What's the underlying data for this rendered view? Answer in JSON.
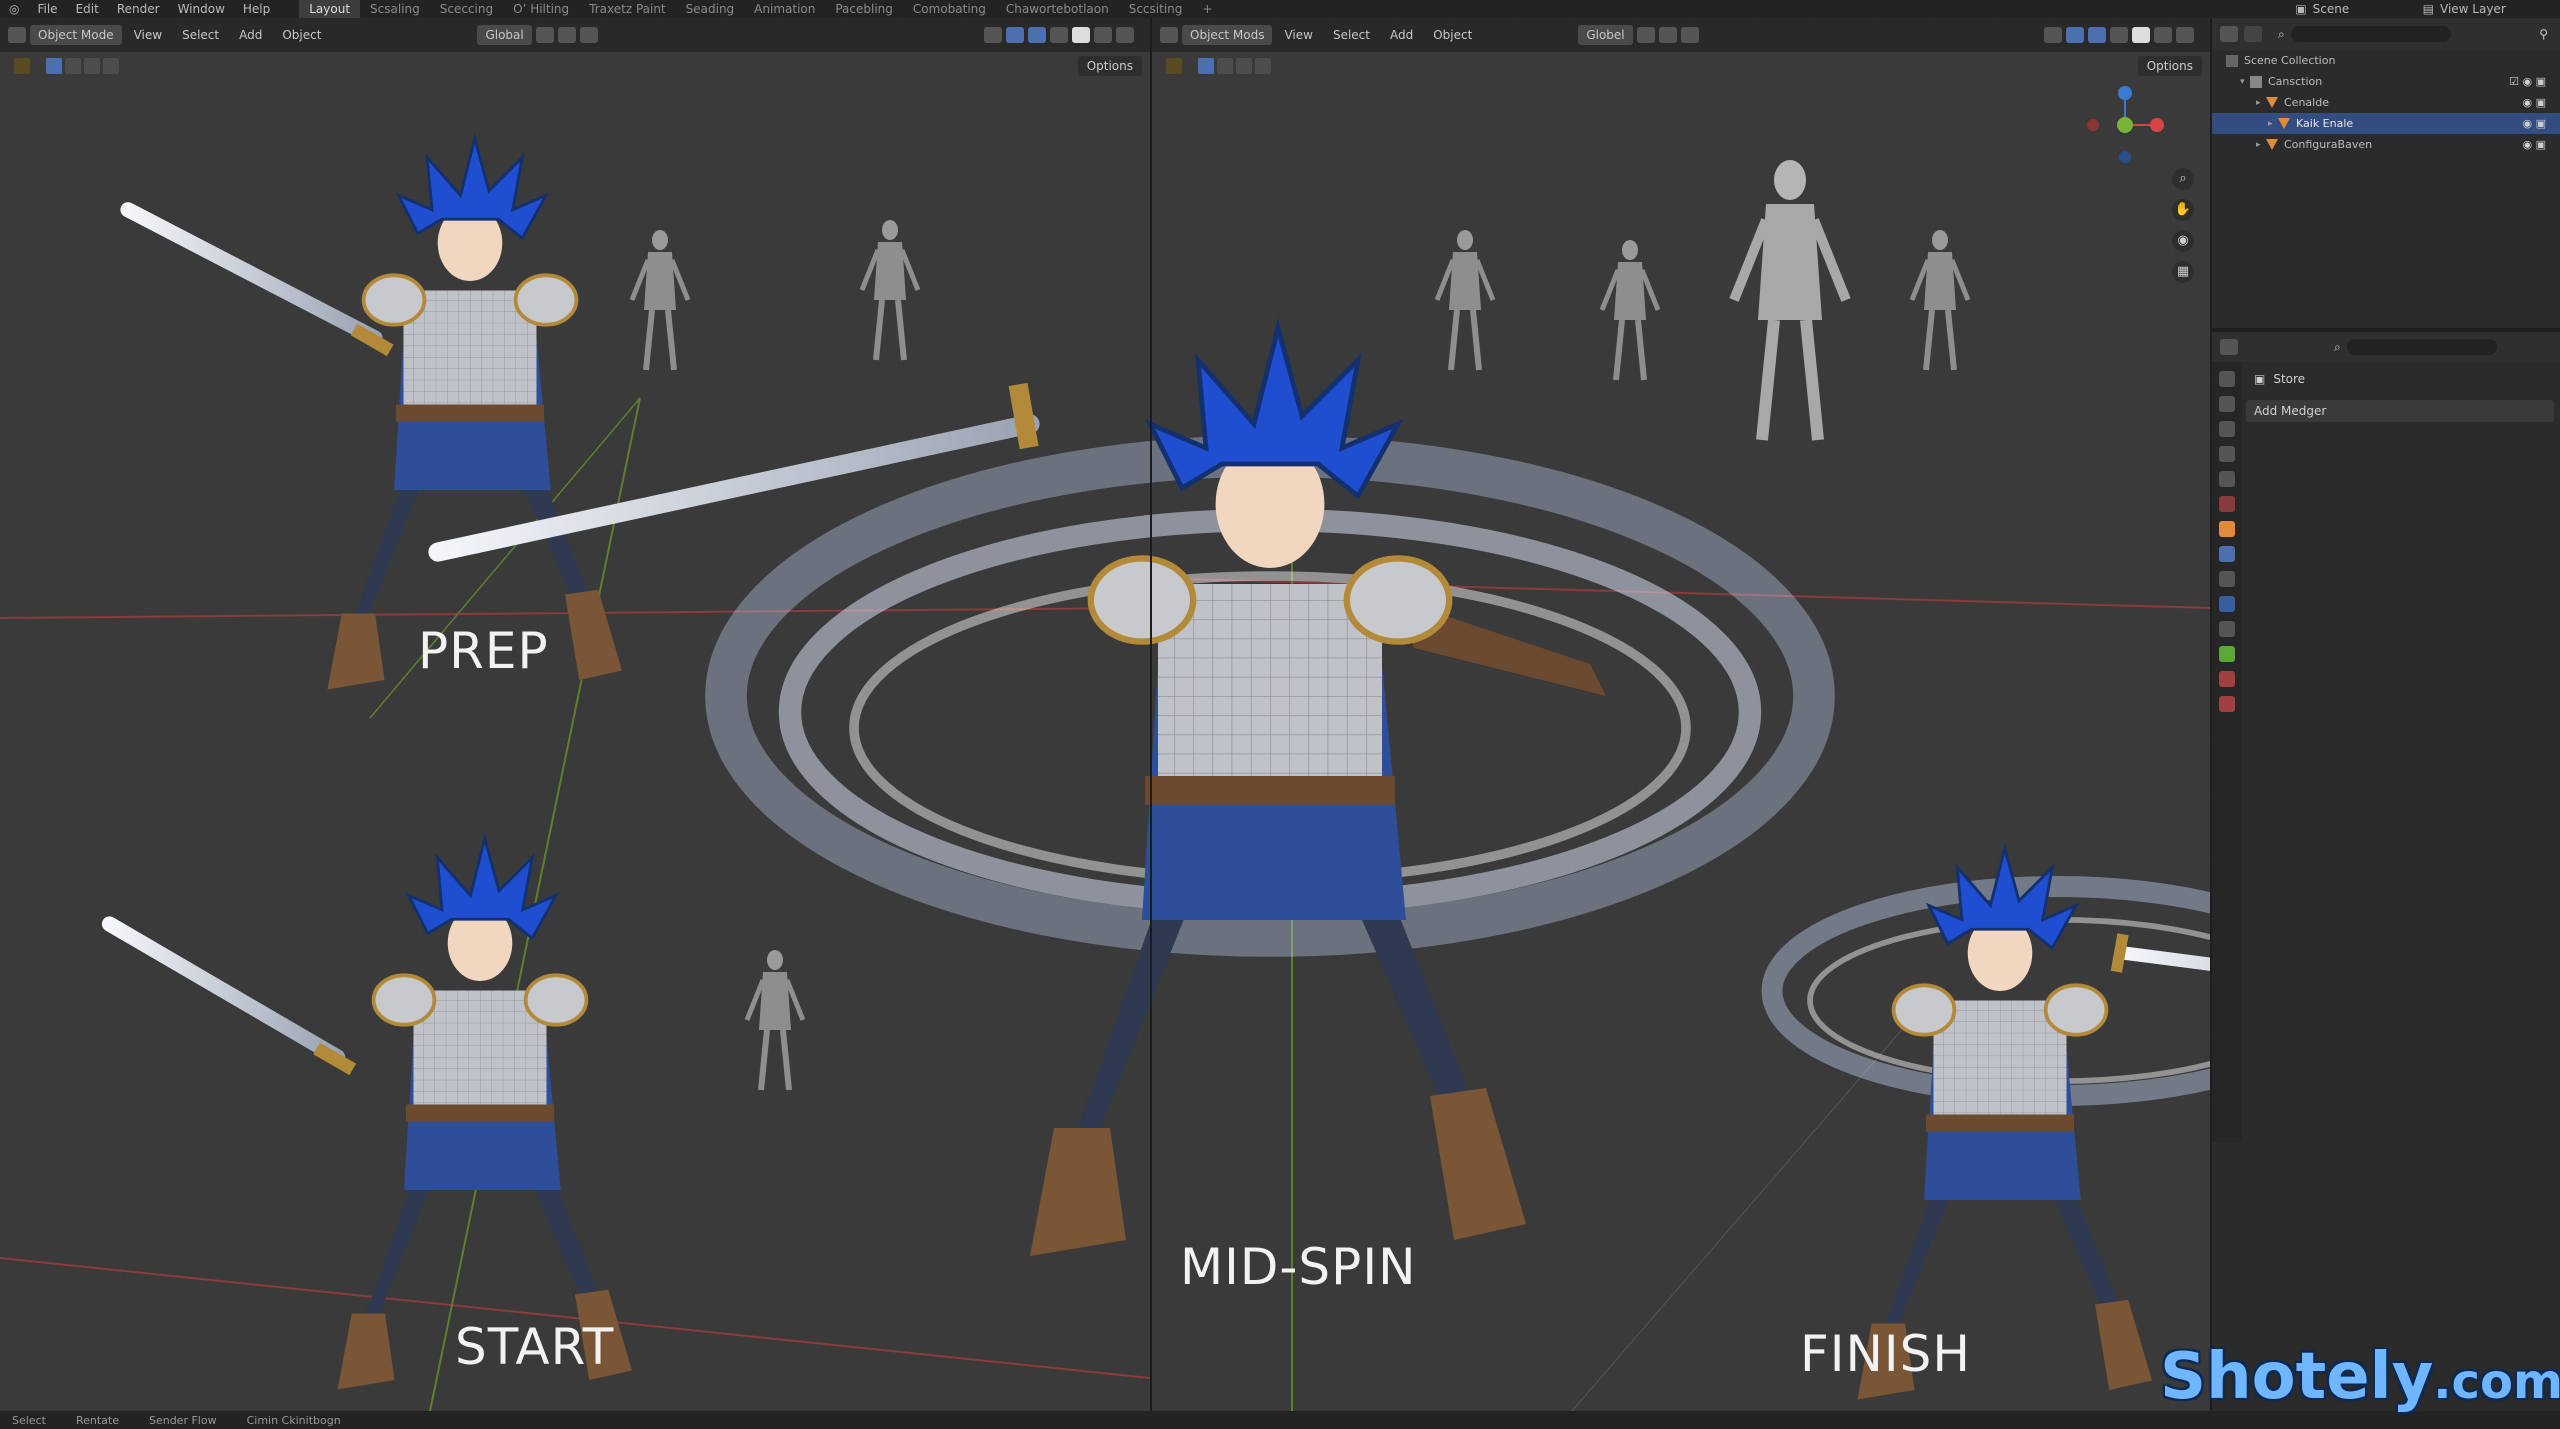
{
  "menu": {
    "items": [
      "File",
      "Edit",
      "Render",
      "Window",
      "Help"
    ],
    "workspaces": [
      "Layout",
      "Scsaling",
      "Sceccing",
      "O’ Hilting",
      "Traxetz Paint",
      "Seading",
      "Animation",
      "Pacebling",
      "Comobating",
      "Chawortebotlaon",
      "Sccsiting",
      "+"
    ],
    "active_workspace": "Layout",
    "scene": "Scene",
    "view_layer": "View Layer"
  },
  "viewport_left": {
    "mode": "Object Mode",
    "menus": [
      "View",
      "Select",
      "Add",
      "Object"
    ],
    "transform": "Global",
    "options": "Options"
  },
  "viewport_right": {
    "mode": "Object Mods",
    "menus": [
      "View",
      "Select",
      "Add",
      "Object"
    ],
    "transform": "Globel",
    "options": "Options"
  },
  "labels": {
    "prep": "PREP",
    "start": "START",
    "mid_spin": "MID-SPIN",
    "finish": "FINISH"
  },
  "outliner": {
    "root": "Scene Collection",
    "collection": "Cansction",
    "items": [
      {
        "name": "Cenalde",
        "selected": false
      },
      {
        "name": "Kaik Enale",
        "selected": true
      },
      {
        "name": "ConfiguraBaven",
        "selected": false
      }
    ]
  },
  "properties": {
    "header": "Store",
    "add_modifier": "Add Medger"
  },
  "statusbar": {
    "items": [
      "Select",
      "Rentate",
      "Sender Flow",
      "Cimin Ckinitbogn"
    ]
  },
  "watermark": {
    "name": "Shotely",
    "tld": ".com"
  },
  "colors": {
    "accent": "#4c6fb0",
    "viewport_bg": "#3a3a3a",
    "hair": "#1f4fd0",
    "armor_blue": "#2f4e9a",
    "swoosh": "#c8dcff",
    "logo": "#6fb6ff"
  }
}
